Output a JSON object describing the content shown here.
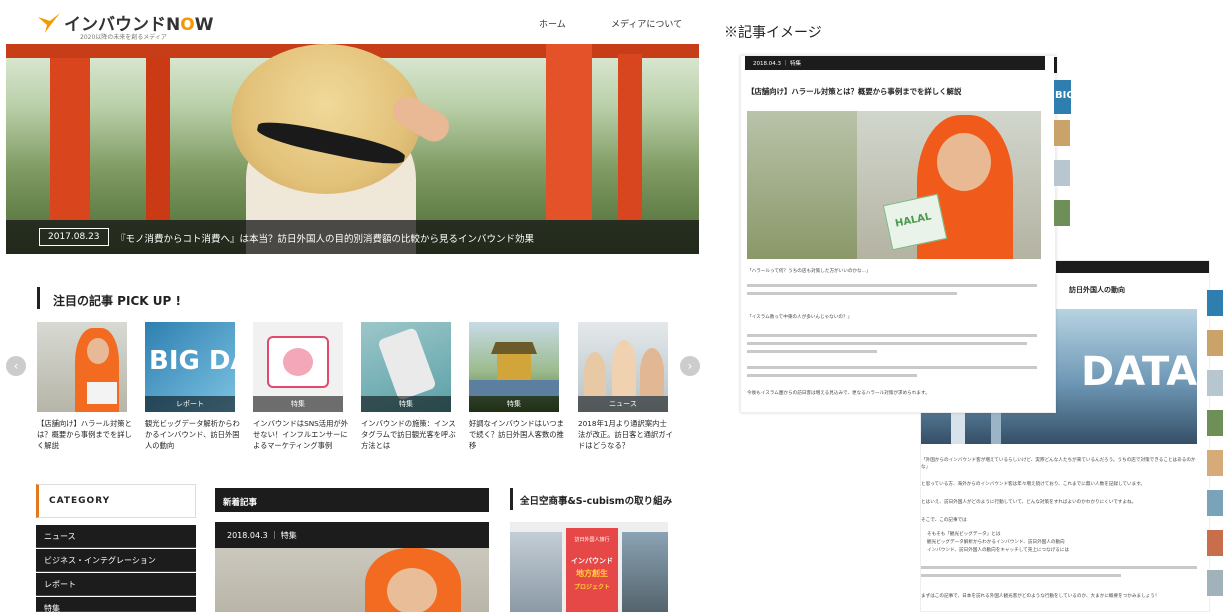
{
  "logo": {
    "text_pre": "インバウンドN",
    "text_o": "O",
    "text_post": "W",
    "subtitle": "2020以降の未来を創るメディア"
  },
  "nav": {
    "home": "ホーム",
    "about": "メディアについて"
  },
  "hero": {
    "date": "2017.08.23",
    "title": "『モノ消費からコト消費へ』は本当？訪日外国人の目的別消費額の比較から見るインバウンド効果"
  },
  "pickup": {
    "heading": "注目の記事 PICK UP !",
    "cards": [
      {
        "tag": "",
        "title": "【店舗向け】ハラール対策とは？概要から事例までを詳しく解説"
      },
      {
        "tag": "レポート",
        "title": "観光ビッグデータ解析からわかるインバウンド、訪日外国人の動向"
      },
      {
        "tag": "特集",
        "title": "インバウンドはSNS活用が外せない！インフルエンサーによるマーケティング事例"
      },
      {
        "tag": "特集",
        "title": "インバウンドの施策：インスタグラムで訪日観光客を呼ぶ方法とは"
      },
      {
        "tag": "特集",
        "title": "好調なインバウンドはいつまで続く？訪日外国人客数の推移"
      },
      {
        "tag": "ニュース",
        "title": "2018年1月より通訳案内士法が改正。訪日客と通訳ガイドはどうなる？"
      }
    ],
    "prev": "‹",
    "next": "›"
  },
  "category": {
    "heading": "CATEGORY",
    "items": [
      "ニュース",
      "ビジネス・インテグレーション",
      "レポート",
      "特集"
    ]
  },
  "new_articles": {
    "heading": "新着記事",
    "meta": "2018.04.3 ｜ 特集"
  },
  "ana": {
    "heading": "全日空商事&S-cubismの取り組み",
    "poster_line1": "訪日外国人旅行",
    "poster_line2": "インバウンド",
    "poster_line3": "地方創生",
    "poster_line4": "プロジェクト"
  },
  "sample": {
    "label": "※記事イメージ",
    "meta": "2018.04.3 ｜ 特集",
    "title": "【店舗向け】ハラール対策とは？概要から事例までを詳しく解説",
    "halal": "HALAL",
    "p1": "「ハラールって何？うちの店も対策した方がいいのかな…」",
    "q2": "「イスラム教って中東の人が多いんじゃないの？」",
    "p_last": "今後もイスラム圏からの訪日客は増える見込みで、更なるハラール対策が求められます。"
  },
  "sample2": {
    "title_tail": "訪日外国人の動向",
    "data_text": "DATA",
    "p1": "「外国からのインバウンド客が増えているらしいけど、実際どんな人たちが来ているんだろう。うちの店で対策できることはあるのかな」",
    "p2": "と思っている方、海外からのインバウンド客は年々増え続けており、これまでに無い人数を記録しています。",
    "p3": "とはいえ、訪日外国人がどのように行動していて、どんな対策をすればよいのかわかりにくいですよね。",
    "p4": "そこで、この記事では",
    "b1": "そもそも「観光ビッグデータ」とは",
    "b2": "観光ビッグデータ解析からわかるインバウンド、訪日外国人の動向",
    "b3": "インバウンド、訪日外国人の動向をキャッチして売上につなげるには",
    "p5": "まずはこの記事で、日本を訪れる外国人観光客がどのような行動をしているのか、大まかに概要をつかみましょう！"
  },
  "bigdata_text": "BIG DATA",
  "big_text": "BIG",
  "colors": {
    "accent": "#e07a1f",
    "dark": "#1c1c1c"
  }
}
